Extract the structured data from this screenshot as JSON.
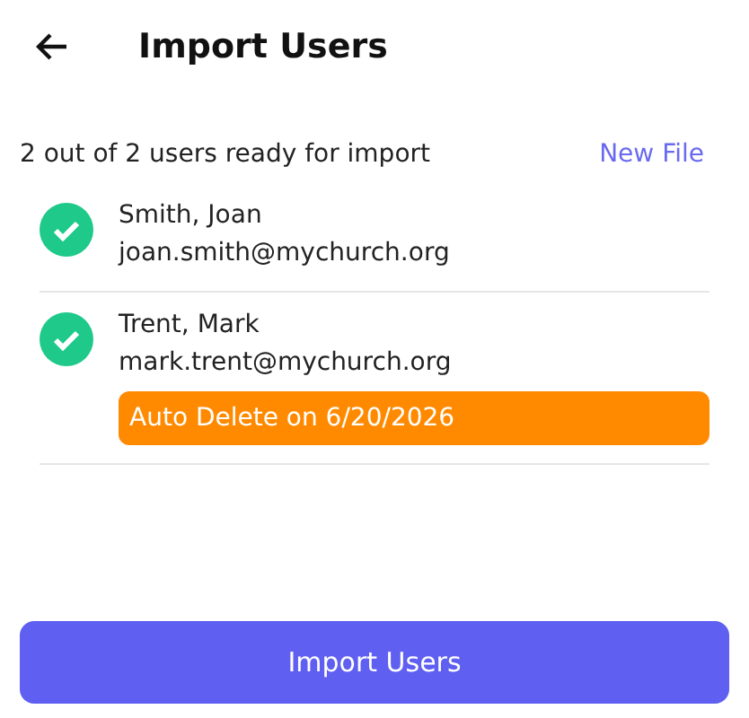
{
  "header": {
    "title": "Import Users"
  },
  "summary": {
    "text": "2 out of 2 users ready for import",
    "action": "New File"
  },
  "users": [
    {
      "name": "Smith, Joan",
      "email": "joan.smith@mychurch.org",
      "ready": true
    },
    {
      "name": "Trent, Mark",
      "email": "mark.trent@mychurch.org",
      "ready": true,
      "notice": "Auto Delete on 6/20/2026"
    }
  ],
  "button": "Import Users"
}
